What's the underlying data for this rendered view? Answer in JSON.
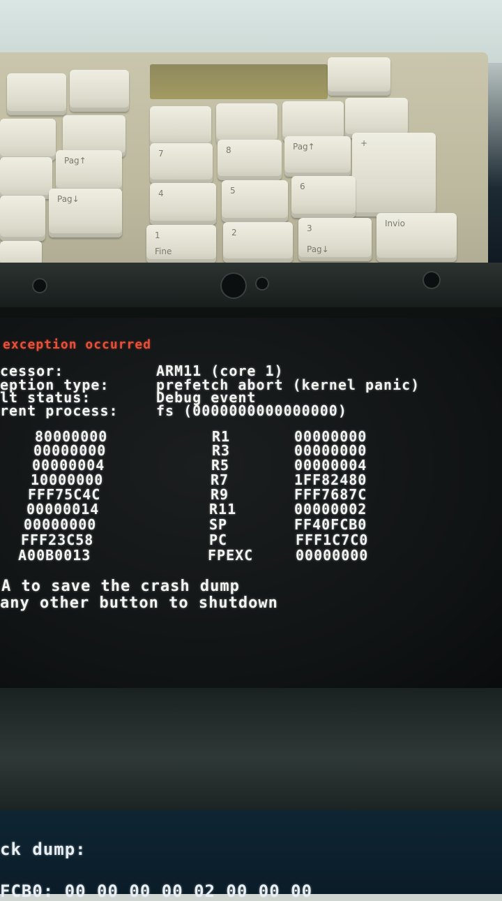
{
  "header": {
    "title": "exception occurred"
  },
  "info": [
    {
      "label": "cessor:",
      "value": "ARM11 (core 1)"
    },
    {
      "label": "eption type:",
      "value": "prefetch abort (kernel panic)"
    },
    {
      "label": "lt status:",
      "value": "Debug event"
    },
    {
      "label": "rent process:",
      "value": "fs (0000000000000000)"
    }
  ],
  "registers": [
    {
      "left_value": "80000000",
      "right_name": "R1",
      "right_value": "00000000"
    },
    {
      "left_value": "00000000",
      "right_name": "R3",
      "right_value": "00000000"
    },
    {
      "left_value": "00000004",
      "right_name": "R5",
      "right_value": "00000004"
    },
    {
      "left_value": "10000000",
      "right_name": "R7",
      "right_value": "1FF82480"
    },
    {
      "left_value": "FFF75C4C",
      "right_name": "R9",
      "right_value": "FFF7687C"
    },
    {
      "left_value": "00000014",
      "right_name": "R11",
      "right_value": "00000002"
    },
    {
      "left_value": "00000000",
      "right_name": "SP",
      "right_value": "FF40FCB0"
    },
    {
      "left_value": "FFF23C58",
      "right_name": "PC",
      "right_value": "FFF1C7C0"
    },
    {
      "left_value": "A00B0013",
      "right_name": "FPEXC",
      "right_value": "00000000"
    }
  ],
  "prompts": [
    "A to save the crash dump",
    "any other button to shutdown"
  ],
  "lower_screen": {
    "heading": "ck dump:",
    "line": "FCB0: 00 00 00 00 02 00 00 00"
  },
  "keyboard": {
    "keys": [
      "Pag↑",
      "Pag↓",
      "7",
      "8",
      "4",
      "5",
      "6",
      "1",
      "Fine",
      "2",
      "3",
      "Pag↓",
      "Invio",
      "+"
    ]
  },
  "colors": {
    "screen_bg": "#111415",
    "text": "#f2f4f2",
    "error_red": "#e8503a"
  }
}
